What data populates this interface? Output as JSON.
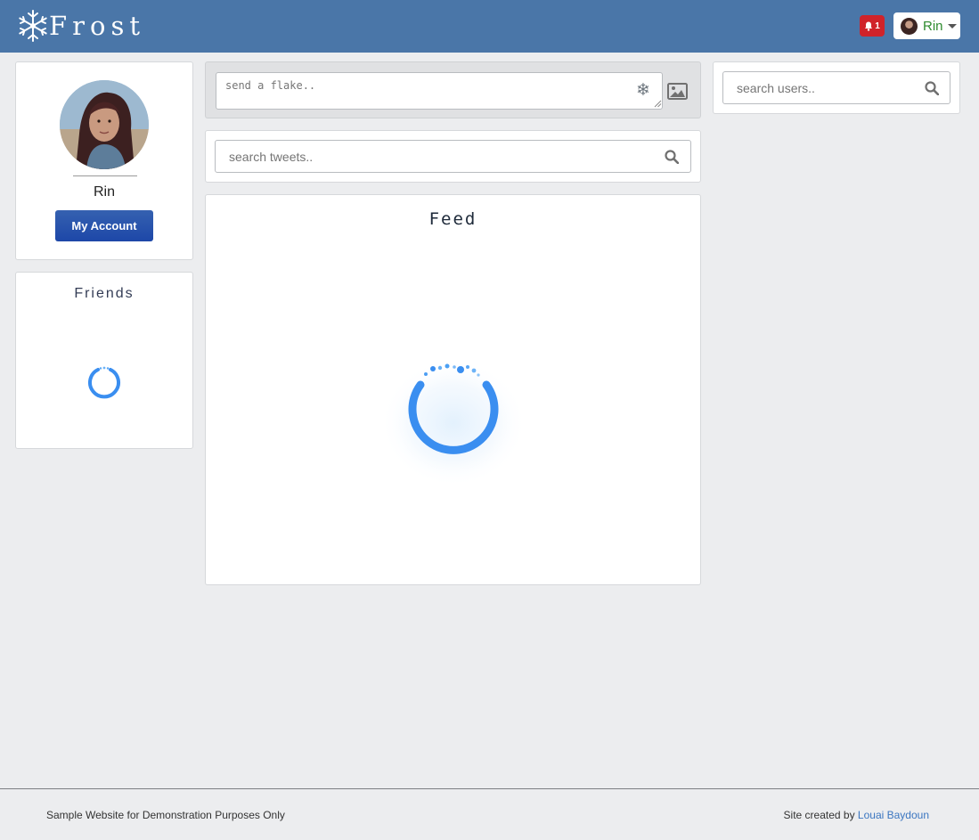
{
  "navbar": {
    "brand": "Frost",
    "notification_count": "1",
    "user_name": "Rin"
  },
  "profile": {
    "name": "Rin",
    "account_button": "My Account"
  },
  "friends": {
    "title": "Friends"
  },
  "composer": {
    "placeholder": "send a flake.."
  },
  "tweet_search": {
    "placeholder": "search tweets.."
  },
  "feed": {
    "title": "Feed"
  },
  "user_search": {
    "placeholder": "search users.."
  },
  "footer": {
    "left_text": "Sample Website for Demonstration Purposes Only",
    "credit_prefix": "Site created by",
    "credit_link": "Louai Baydoun"
  },
  "colors": {
    "navbar": "#4a76a8",
    "notification_badge": "#d0232a",
    "account_button": "#2553ac",
    "spinner": "#3a8ef0",
    "page_background": "#ecedef"
  },
  "icons": [
    "snowflake-logo-icon",
    "bell-icon",
    "avatar",
    "chevron-down-icon",
    "snowflake-icon",
    "image-icon",
    "search-icon",
    "loading-spinner"
  ]
}
